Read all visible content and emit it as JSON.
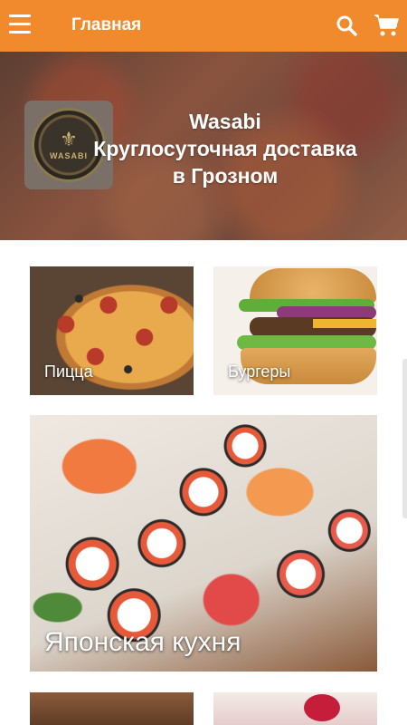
{
  "appbar": {
    "title": "Главная",
    "menu_icon": "hamburger-menu-icon",
    "search_icon": "search-icon",
    "cart_icon": "cart-icon",
    "color": "#f08a2d"
  },
  "hero": {
    "logo_text": "WASABI",
    "headline_line1": "Wasabi",
    "headline_line2": "Круглосуточная доставка",
    "headline_line3": "в Грозном"
  },
  "categories": [
    {
      "label": "Пицца"
    },
    {
      "label": "Бургеры"
    },
    {
      "label": "Японская кухня"
    }
  ]
}
